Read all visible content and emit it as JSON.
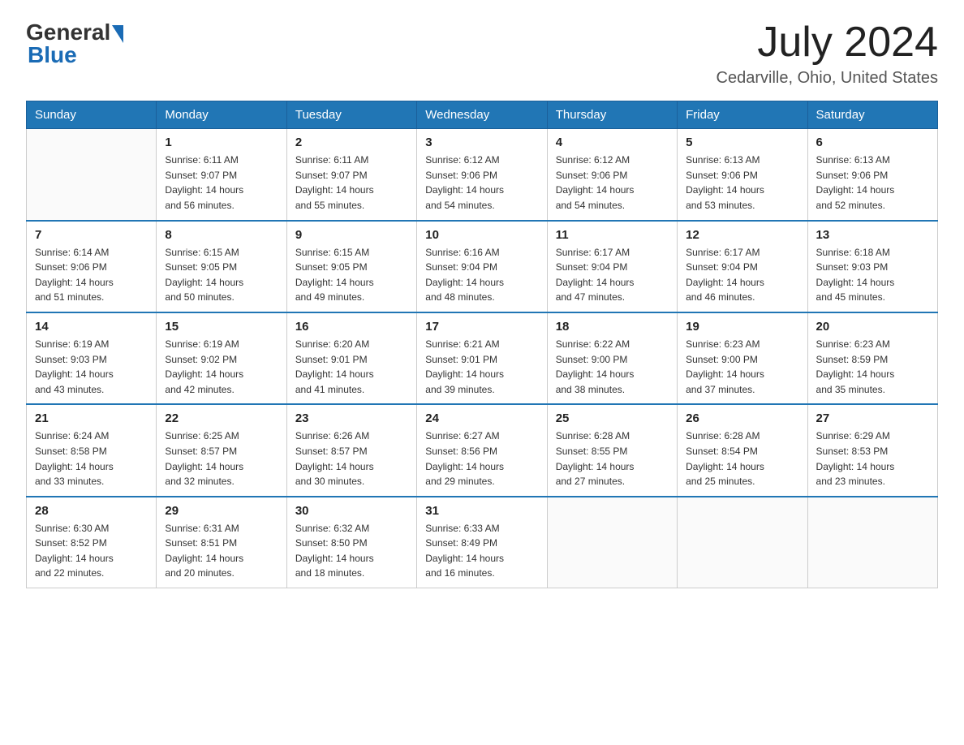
{
  "header": {
    "logo_general": "General",
    "logo_blue": "Blue",
    "month_year": "July 2024",
    "location": "Cedarville, Ohio, United States"
  },
  "weekdays": [
    "Sunday",
    "Monday",
    "Tuesday",
    "Wednesday",
    "Thursday",
    "Friday",
    "Saturday"
  ],
  "weeks": [
    [
      {
        "day": "",
        "info": ""
      },
      {
        "day": "1",
        "info": "Sunrise: 6:11 AM\nSunset: 9:07 PM\nDaylight: 14 hours\nand 56 minutes."
      },
      {
        "day": "2",
        "info": "Sunrise: 6:11 AM\nSunset: 9:07 PM\nDaylight: 14 hours\nand 55 minutes."
      },
      {
        "day": "3",
        "info": "Sunrise: 6:12 AM\nSunset: 9:06 PM\nDaylight: 14 hours\nand 54 minutes."
      },
      {
        "day": "4",
        "info": "Sunrise: 6:12 AM\nSunset: 9:06 PM\nDaylight: 14 hours\nand 54 minutes."
      },
      {
        "day": "5",
        "info": "Sunrise: 6:13 AM\nSunset: 9:06 PM\nDaylight: 14 hours\nand 53 minutes."
      },
      {
        "day": "6",
        "info": "Sunrise: 6:13 AM\nSunset: 9:06 PM\nDaylight: 14 hours\nand 52 minutes."
      }
    ],
    [
      {
        "day": "7",
        "info": "Sunrise: 6:14 AM\nSunset: 9:06 PM\nDaylight: 14 hours\nand 51 minutes."
      },
      {
        "day": "8",
        "info": "Sunrise: 6:15 AM\nSunset: 9:05 PM\nDaylight: 14 hours\nand 50 minutes."
      },
      {
        "day": "9",
        "info": "Sunrise: 6:15 AM\nSunset: 9:05 PM\nDaylight: 14 hours\nand 49 minutes."
      },
      {
        "day": "10",
        "info": "Sunrise: 6:16 AM\nSunset: 9:04 PM\nDaylight: 14 hours\nand 48 minutes."
      },
      {
        "day": "11",
        "info": "Sunrise: 6:17 AM\nSunset: 9:04 PM\nDaylight: 14 hours\nand 47 minutes."
      },
      {
        "day": "12",
        "info": "Sunrise: 6:17 AM\nSunset: 9:04 PM\nDaylight: 14 hours\nand 46 minutes."
      },
      {
        "day": "13",
        "info": "Sunrise: 6:18 AM\nSunset: 9:03 PM\nDaylight: 14 hours\nand 45 minutes."
      }
    ],
    [
      {
        "day": "14",
        "info": "Sunrise: 6:19 AM\nSunset: 9:03 PM\nDaylight: 14 hours\nand 43 minutes."
      },
      {
        "day": "15",
        "info": "Sunrise: 6:19 AM\nSunset: 9:02 PM\nDaylight: 14 hours\nand 42 minutes."
      },
      {
        "day": "16",
        "info": "Sunrise: 6:20 AM\nSunset: 9:01 PM\nDaylight: 14 hours\nand 41 minutes."
      },
      {
        "day": "17",
        "info": "Sunrise: 6:21 AM\nSunset: 9:01 PM\nDaylight: 14 hours\nand 39 minutes."
      },
      {
        "day": "18",
        "info": "Sunrise: 6:22 AM\nSunset: 9:00 PM\nDaylight: 14 hours\nand 38 minutes."
      },
      {
        "day": "19",
        "info": "Sunrise: 6:23 AM\nSunset: 9:00 PM\nDaylight: 14 hours\nand 37 minutes."
      },
      {
        "day": "20",
        "info": "Sunrise: 6:23 AM\nSunset: 8:59 PM\nDaylight: 14 hours\nand 35 minutes."
      }
    ],
    [
      {
        "day": "21",
        "info": "Sunrise: 6:24 AM\nSunset: 8:58 PM\nDaylight: 14 hours\nand 33 minutes."
      },
      {
        "day": "22",
        "info": "Sunrise: 6:25 AM\nSunset: 8:57 PM\nDaylight: 14 hours\nand 32 minutes."
      },
      {
        "day": "23",
        "info": "Sunrise: 6:26 AM\nSunset: 8:57 PM\nDaylight: 14 hours\nand 30 minutes."
      },
      {
        "day": "24",
        "info": "Sunrise: 6:27 AM\nSunset: 8:56 PM\nDaylight: 14 hours\nand 29 minutes."
      },
      {
        "day": "25",
        "info": "Sunrise: 6:28 AM\nSunset: 8:55 PM\nDaylight: 14 hours\nand 27 minutes."
      },
      {
        "day": "26",
        "info": "Sunrise: 6:28 AM\nSunset: 8:54 PM\nDaylight: 14 hours\nand 25 minutes."
      },
      {
        "day": "27",
        "info": "Sunrise: 6:29 AM\nSunset: 8:53 PM\nDaylight: 14 hours\nand 23 minutes."
      }
    ],
    [
      {
        "day": "28",
        "info": "Sunrise: 6:30 AM\nSunset: 8:52 PM\nDaylight: 14 hours\nand 22 minutes."
      },
      {
        "day": "29",
        "info": "Sunrise: 6:31 AM\nSunset: 8:51 PM\nDaylight: 14 hours\nand 20 minutes."
      },
      {
        "day": "30",
        "info": "Sunrise: 6:32 AM\nSunset: 8:50 PM\nDaylight: 14 hours\nand 18 minutes."
      },
      {
        "day": "31",
        "info": "Sunrise: 6:33 AM\nSunset: 8:49 PM\nDaylight: 14 hours\nand 16 minutes."
      },
      {
        "day": "",
        "info": ""
      },
      {
        "day": "",
        "info": ""
      },
      {
        "day": "",
        "info": ""
      }
    ]
  ]
}
